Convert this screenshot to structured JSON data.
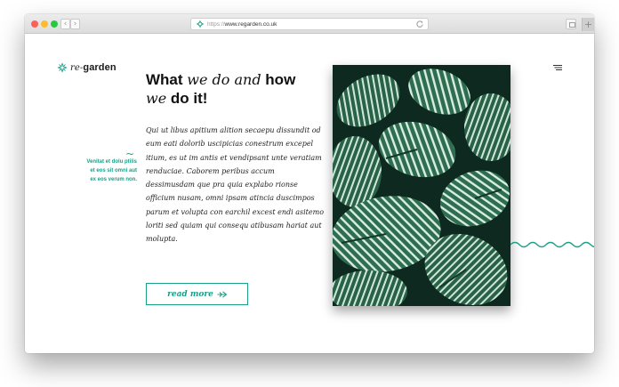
{
  "browser": {
    "url_protocol": "https://",
    "url_host": "www.regarden.co.uk",
    "back_glyph": "‹",
    "forward_glyph": "›",
    "new_tab_glyph": "+"
  },
  "site": {
    "logo_prefix": "re-",
    "logo_name": "garden",
    "accent_color": "#1aa086"
  },
  "hero": {
    "headline_part1": "What ",
    "headline_italic1": "we do and",
    "headline_part2": " how ",
    "headline_italic2": "we",
    "headline_part3": " do it!",
    "side_tilde": "~",
    "side_note": "Venitat et dolu ptilis et eos sit omni aut ex eos verum non.",
    "body": "Qui ut libus apitium alition secaepu dissundit od eum eati dolorib uscipicias conestrum excepel itium, es ut im antis et vendipsant unte veratiam renduciae. Caborem peribus accum dessimusdam que pra quia explabo rionse officium nusam, omni ipsam atincia duscimpos parum et volupta con earchil excest endi asitemo loriti sed quiam qui consequ atibusam hariat aut molupta.",
    "cta_label": "read more"
  },
  "icons": {
    "logo": "leaf-flower-icon",
    "menu": "hamburger-menu-icon",
    "cta_arrow": "paper-plane-arrow-icon",
    "decoration": "wave-line-icon"
  }
}
